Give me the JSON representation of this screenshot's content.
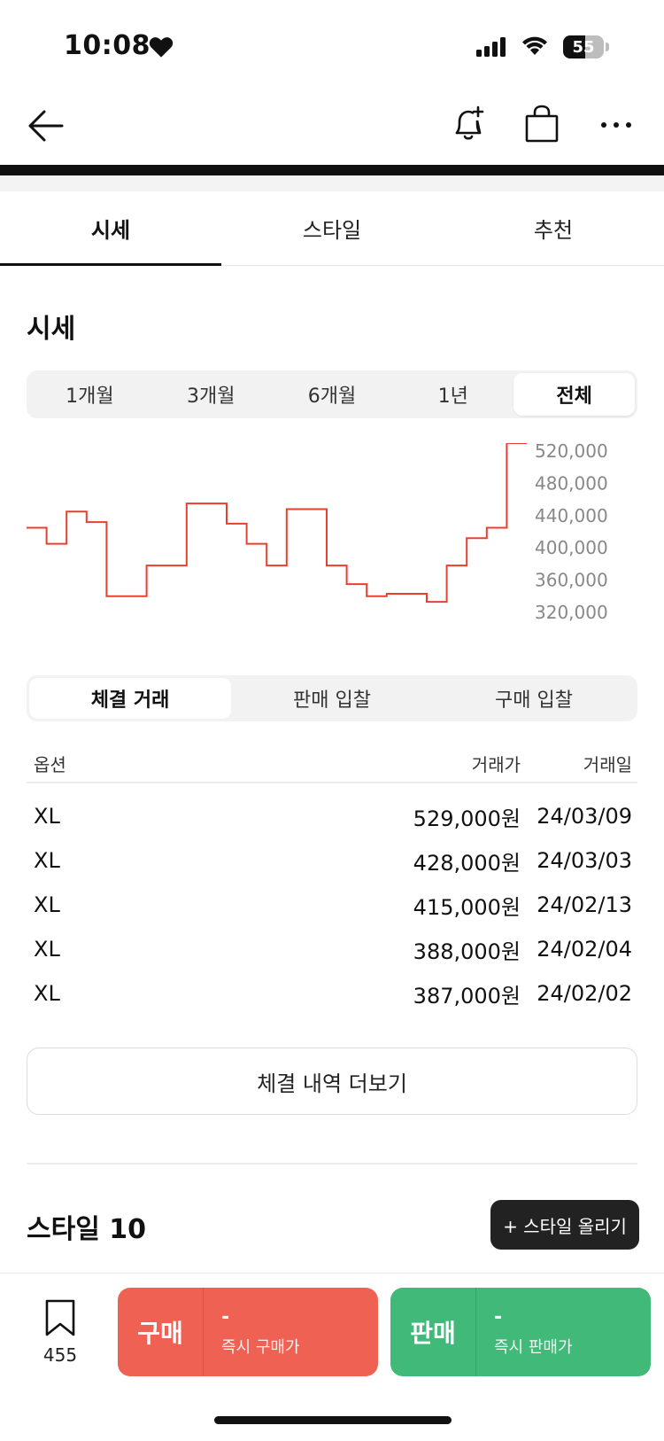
{
  "status_bar": {
    "time": "10:08",
    "battery": "55",
    "battery_level": 0.55
  },
  "tabs": [
    {
      "label": "시세",
      "active": true
    },
    {
      "label": "스타일",
      "active": false
    },
    {
      "label": "추천",
      "active": false
    }
  ],
  "price_section": {
    "title": "시세"
  },
  "periods": [
    {
      "label": "1개월",
      "active": false
    },
    {
      "label": "3개월",
      "active": false
    },
    {
      "label": "6개월",
      "active": false
    },
    {
      "label": "1년",
      "active": false
    },
    {
      "label": "전체",
      "active": true
    }
  ],
  "chart_data": {
    "type": "line",
    "title": "",
    "xlabel": "",
    "ylabel": "",
    "ylim": [
      310000,
      530000
    ],
    "y_ticks": [
      "520,000",
      "480,000",
      "440,000",
      "400,000",
      "360,000",
      "320,000"
    ],
    "y_tick_values": [
      520000,
      480000,
      440000,
      400000,
      360000,
      320000
    ],
    "grid": false,
    "line_color": "#e8402f",
    "series": [
      {
        "values": [
          425000,
          405000,
          445000,
          432000,
          340000,
          340000,
          378000,
          378000,
          455000,
          455000,
          430000,
          405000,
          378000,
          448000,
          448000,
          378000,
          355000,
          340000,
          343000,
          343000,
          333000,
          378000,
          412000,
          425000,
          530000,
          530000
        ]
      }
    ]
  },
  "trade_types": [
    {
      "label": "체결 거래",
      "active": true
    },
    {
      "label": "판매 입찰",
      "active": false
    },
    {
      "label": "구매 입찰",
      "active": false
    }
  ],
  "transactions": {
    "headers": {
      "option": "옵션",
      "price": "거래가",
      "date": "거래일"
    },
    "rows": [
      {
        "option": "XL",
        "price": "529,000원",
        "date": "24/03/09"
      },
      {
        "option": "XL",
        "price": "428,000원",
        "date": "24/03/03"
      },
      {
        "option": "XL",
        "price": "415,000원",
        "date": "24/02/13"
      },
      {
        "option": "XL",
        "price": "388,000원",
        "date": "24/02/04"
      },
      {
        "option": "XL",
        "price": "387,000원",
        "date": "24/02/02"
      }
    ]
  },
  "more_button_label": "체결 내역 더보기",
  "style_section": {
    "title": "스타일 10",
    "upload_label": "+ 스타일 올리기"
  },
  "bottom_bar": {
    "bookmark_count": "455",
    "buy": {
      "label": "구매",
      "price": "-",
      "sub": "즉시 구매가",
      "color": "#ef6253"
    },
    "sell": {
      "label": "판매",
      "price": "-",
      "sub": "즉시 판매가",
      "color": "#41b979"
    }
  }
}
